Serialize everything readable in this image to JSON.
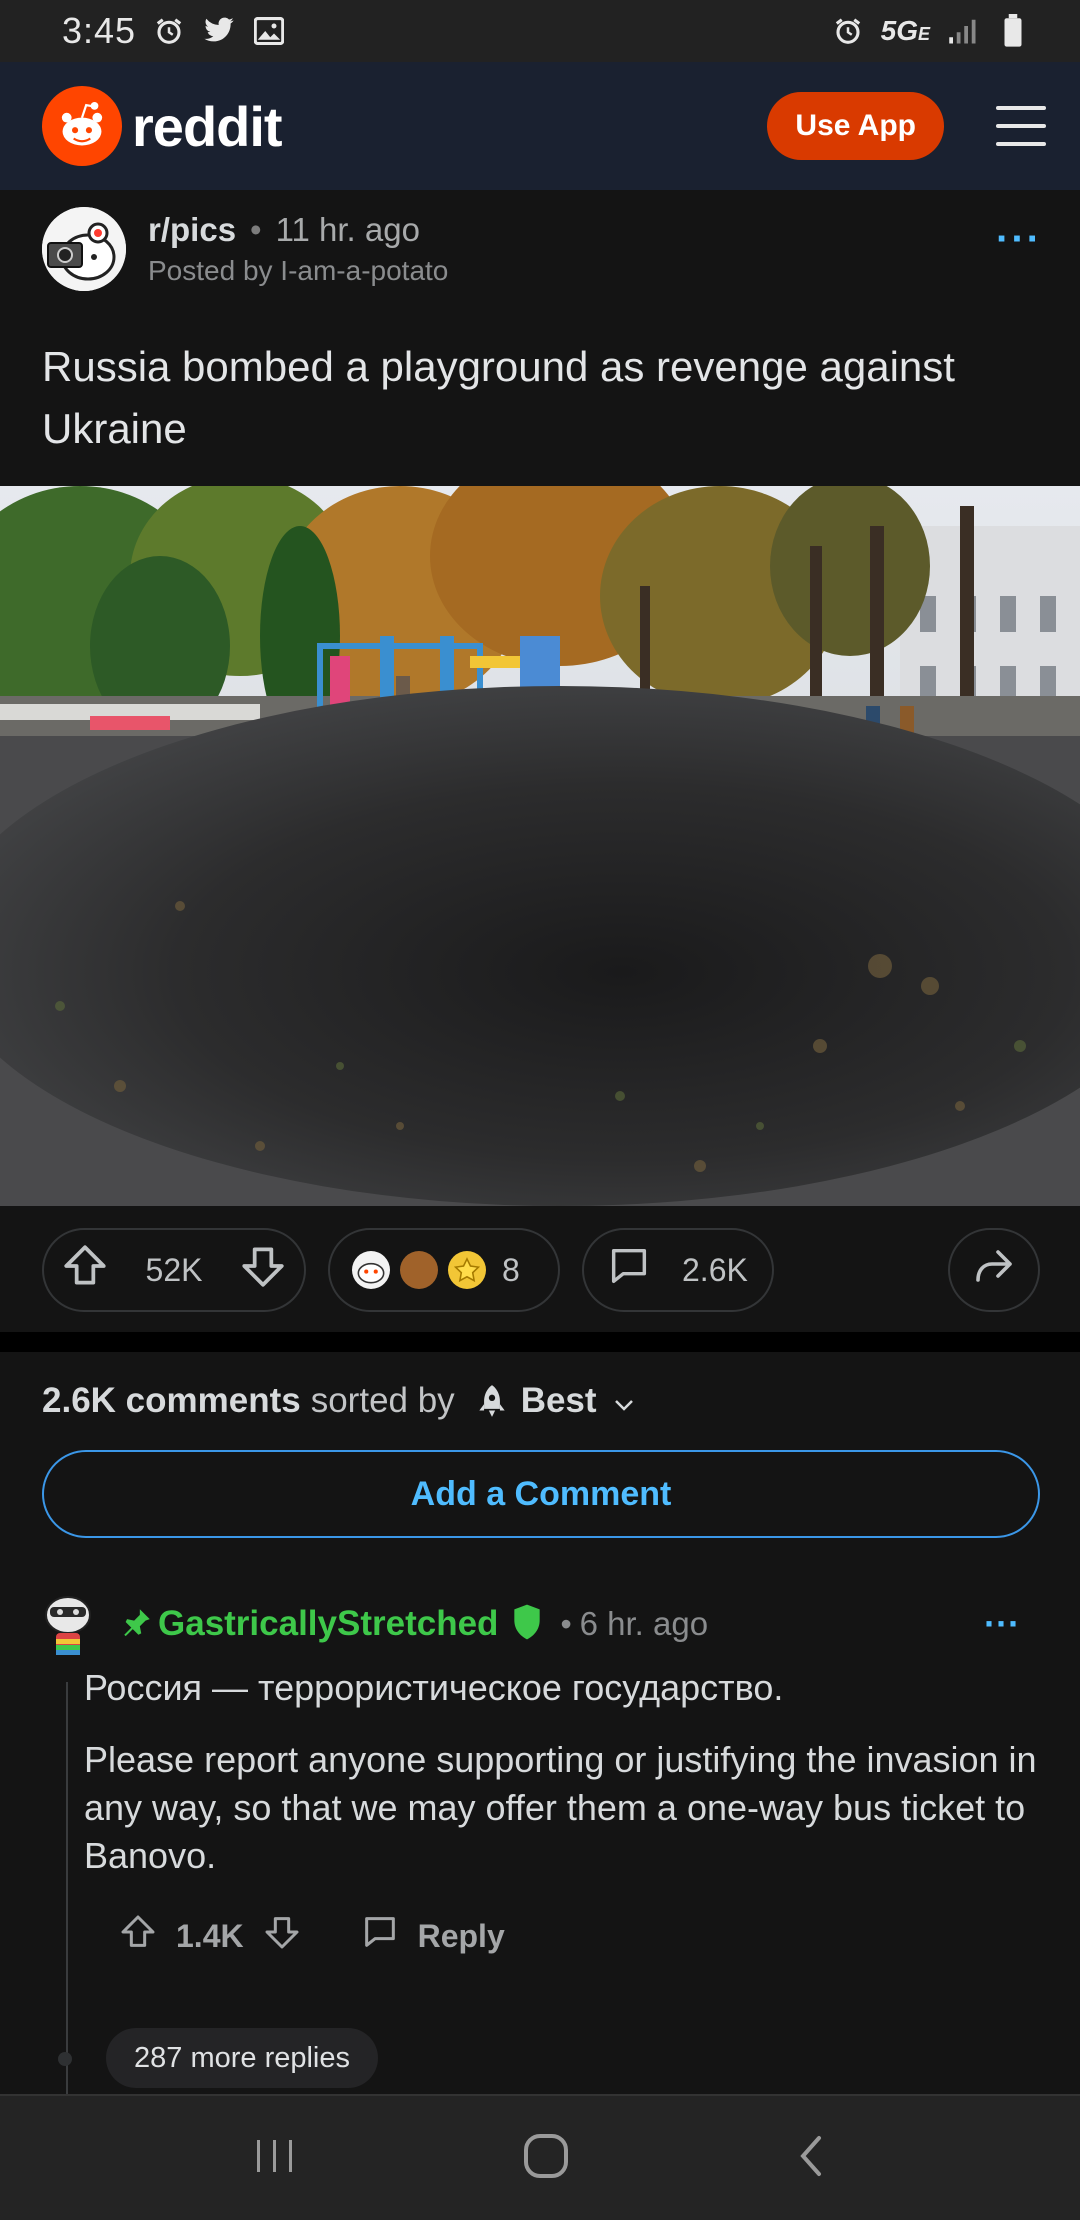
{
  "status_bar": {
    "time": "3:45",
    "network": "5G",
    "network_sub": "E",
    "left_icons": [
      "alarm-icon",
      "twitter-icon",
      "gallery-icon"
    ],
    "right_icons": [
      "alarm-icon",
      "signal-icon",
      "battery-icon"
    ]
  },
  "header": {
    "brand": "reddit",
    "use_app_label": "Use App",
    "accent": "#ff4500"
  },
  "post": {
    "subreddit": "r/pics",
    "age": "11 hr. ago",
    "posted_by": "Posted by I-am-a-potato",
    "title": "Russia bombed a playground as revenge against Ukraine",
    "upvotes": "52K",
    "award_count": "8",
    "comment_count": "2.6K"
  },
  "comments_section": {
    "count_label": "2.6K comments",
    "sorted_by": "sorted by",
    "sort_value": "Best",
    "add_comment_label": "Add a Comment"
  },
  "comment": {
    "author": "GastricallyStretched",
    "age": "6 hr. ago",
    "body_line1": "Россия — террористическое государство.",
    "body_line2": "Please report anyone supporting or justifying the invasion in any way, so that we may offer them a one-way bus ticket to Banovo.",
    "score": "1.4K",
    "reply_label": "Reply",
    "more_replies": "287 more replies",
    "author_color": "#3ec84a"
  }
}
